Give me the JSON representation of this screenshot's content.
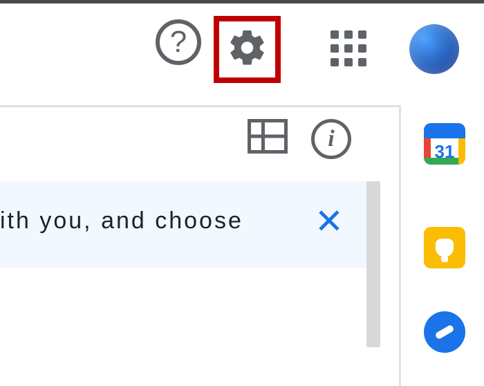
{
  "header": {
    "help_tooltip": "?",
    "calendar_day": "31",
    "info_glyph": "i"
  },
  "banner": {
    "text_fragment": "ith you, and choose",
    "close_glyph": "✕"
  }
}
